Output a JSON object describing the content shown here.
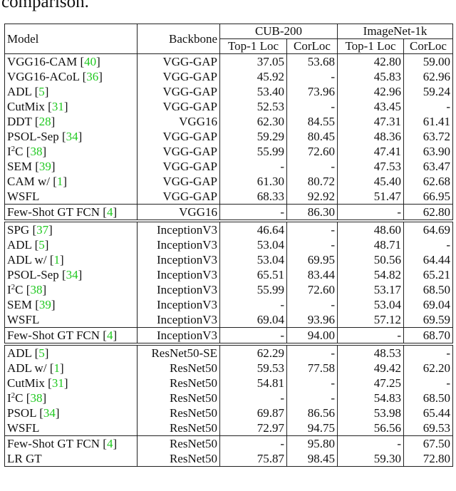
{
  "caption_tail": "comparison.",
  "table": {
    "headers": {
      "model": "Model",
      "backbone": "Backbone",
      "datasets": [
        "CUB-200",
        "ImageNet-1k"
      ],
      "metrics": [
        "Top-1 Loc",
        "CorLoc",
        "Top-1 Loc",
        "CorLoc"
      ]
    },
    "ref_color": "#1ec81e",
    "groups": [
      {
        "rows": [
          {
            "name": "VGG16-CAM",
            "ref": "40",
            "backbone": "VGG-GAP",
            "values": [
              "37.05",
              "53.68",
              "42.80",
              "59.00"
            ],
            "bold": false
          },
          {
            "name": "VGG16-ACoL",
            "ref": "36",
            "backbone": "VGG-GAP",
            "values": [
              "45.92",
              "-",
              "45.83",
              "62.96"
            ],
            "bold": false
          },
          {
            "name": "ADL",
            "ref": "5",
            "backbone": "VGG-GAP",
            "values": [
              "53.40",
              "73.96",
              "42.96",
              "59.24"
            ],
            "bold": false
          },
          {
            "name": "CutMix",
            "ref": "31",
            "backbone": "VGG-GAP",
            "values": [
              "52.53",
              "-",
              "43.45",
              "-"
            ],
            "bold": false
          },
          {
            "name": "DDT",
            "ref": "28",
            "backbone": "VGG16",
            "values": [
              "62.30",
              "84.55",
              "47.31",
              "61.41"
            ],
            "bold": false
          },
          {
            "name": "PSOL-Sep",
            "ref": "34",
            "backbone": "VGG-GAP",
            "values": [
              "59.29",
              "80.45",
              "48.36",
              "63.72"
            ],
            "bold": false
          },
          {
            "name": "I",
            "sup": "2",
            "name_after": "C",
            "ref": "38",
            "backbone": "VGG-GAP",
            "values": [
              "55.99",
              "72.60",
              "47.41",
              "63.90"
            ],
            "bold": false
          },
          {
            "name": "SEM",
            "ref": "39",
            "backbone": "VGG-GAP",
            "values": [
              "-",
              "-",
              "47.53",
              "63.47"
            ],
            "bold": false
          },
          {
            "name": "CAM w/",
            "ref": "1",
            "backbone": "VGG-GAP",
            "values": [
              "61.30",
              "80.72",
              "45.40",
              "62.68"
            ],
            "bold": false
          },
          {
            "name": "WSFL",
            "ref": null,
            "backbone": "VGG-GAP",
            "values": [
              "68.33",
              "92.92",
              "51.47",
              "66.95"
            ],
            "bold": true
          }
        ],
        "fewshot": [
          {
            "name": "Few-Shot GT FCN",
            "ref": "4",
            "backbone": "VGG16",
            "values": [
              "-",
              "86.30",
              "-",
              "62.80"
            ],
            "bold": false
          }
        ]
      },
      {
        "rows": [
          {
            "name": "SPG",
            "ref": "37",
            "backbone": "InceptionV3",
            "values": [
              "46.64",
              "-",
              "48.60",
              "64.69"
            ],
            "bold": false
          },
          {
            "name": "ADL",
            "ref": "5",
            "backbone": "InceptionV3",
            "values": [
              "53.04",
              "-",
              "48.71",
              "-"
            ],
            "bold": false
          },
          {
            "name": "ADL w/",
            "ref": "1",
            "backbone": "InceptionV3",
            "values": [
              "53.04",
              "69.95",
              "50.56",
              "64.44"
            ],
            "bold": false
          },
          {
            "name": "PSOL-Sep",
            "ref": "34",
            "backbone": "InceptionV3",
            "values": [
              "65.51",
              "83.44",
              "54.82",
              "65.21"
            ],
            "bold": false
          },
          {
            "name": "I",
            "sup": "2",
            "name_after": "C",
            "ref": "38",
            "backbone": "InceptionV3",
            "values": [
              "55.99",
              "72.60",
              "53.17",
              "68.50"
            ],
            "bold": false
          },
          {
            "name": "SEM",
            "ref": "39",
            "backbone": "InceptionV3",
            "values": [
              "-",
              "-",
              "53.04",
              "69.04"
            ],
            "bold": false
          },
          {
            "name": "WSFL",
            "ref": null,
            "backbone": "InceptionV3",
            "values": [
              "69.04",
              "93.96",
              "57.12",
              "69.59"
            ],
            "bold": true
          }
        ],
        "fewshot": [
          {
            "name": "Few-Shot GT FCN",
            "ref": "4",
            "backbone": "InceptionV3",
            "values": [
              "-",
              "94.00",
              "-",
              "68.70"
            ],
            "bold": false
          }
        ]
      },
      {
        "rows": [
          {
            "name": "ADL",
            "ref": "5",
            "backbone": "ResNet50-SE",
            "values": [
              "62.29",
              "-",
              "48.53",
              "-"
            ],
            "bold": false
          },
          {
            "name": "ADL w/",
            "ref": "1",
            "backbone": "ResNet50",
            "values": [
              "59.53",
              "77.58",
              "49.42",
              "62.20"
            ],
            "bold": false
          },
          {
            "name": "CutMix",
            "ref": "31",
            "backbone": "ResNet50",
            "values": [
              "54.81",
              "-",
              "47.25",
              "-"
            ],
            "bold": false
          },
          {
            "name": "I",
            "sup": "2",
            "name_after": "C",
            "ref": "38",
            "backbone": "ResNet50",
            "values": [
              "-",
              "-",
              "54.83",
              "68.50"
            ],
            "bold": false
          },
          {
            "name": "PSOL",
            "ref": "34",
            "backbone": "ResNet50",
            "values": [
              "69.87",
              "86.56",
              "53.98",
              "65.44"
            ],
            "bold": false
          },
          {
            "name": "WSFL",
            "ref": null,
            "backbone": "ResNet50",
            "values": [
              "72.97",
              "94.75",
              "56.56",
              "69.53"
            ],
            "bold": true
          }
        ],
        "fewshot": [
          {
            "name": "Few-Shot GT FCN",
            "ref": "4",
            "backbone": "ResNet50",
            "values": [
              "-",
              "95.80",
              "-",
              "67.50"
            ],
            "bold": false
          },
          {
            "name": "LR GT",
            "ref": null,
            "backbone": "ResNet50",
            "values": [
              "75.87",
              "98.45",
              "59.30",
              "72.80"
            ],
            "bold": false
          }
        ]
      }
    ]
  }
}
